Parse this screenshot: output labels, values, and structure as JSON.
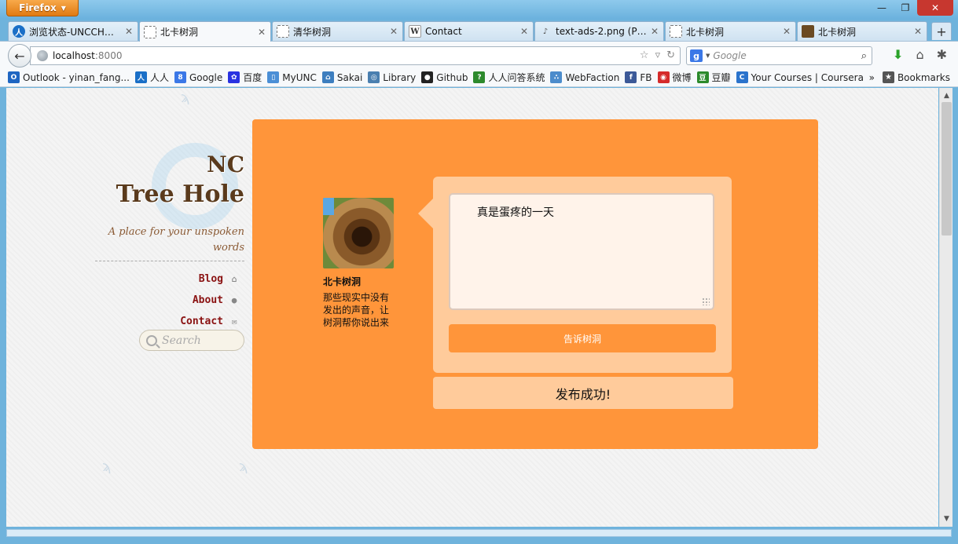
{
  "browser": {
    "app_button": "Firefox",
    "tabs": [
      {
        "label": "浏览状态-UNCCH树...",
        "icon": "renren-icon"
      },
      {
        "label": "北卡树洞",
        "icon": "blank-page-icon"
      },
      {
        "label": "清华树洞",
        "icon": "blank-page-icon"
      },
      {
        "label": "Contact",
        "icon": "w-icon"
      },
      {
        "label": "text-ads-2.png (PNG I...",
        "icon": "image-icon"
      },
      {
        "label": "北卡树洞",
        "icon": "blank-page-icon"
      },
      {
        "label": "北卡树洞",
        "icon": "tree-hole-icon"
      }
    ],
    "active_tab": 1,
    "url_host": "localhost",
    "url_port": ":8000",
    "search_placeholder": "Google",
    "bookmarks": [
      {
        "label": "Outlook - yinan_fang...",
        "icon": "outlook-icon",
        "color": "#1f66c2"
      },
      {
        "label": "人人",
        "icon": "renren-icon",
        "color": "#1a6fc7"
      },
      {
        "label": "Google",
        "icon": "google-icon",
        "color": "#3b78e7"
      },
      {
        "label": "百度",
        "icon": "baidu-paw-icon",
        "color": "#2932e1"
      },
      {
        "label": "MyUNC",
        "icon": "myunc-icon",
        "color": "#4b8fd6"
      },
      {
        "label": "Sakai",
        "icon": "sakai-icon",
        "color": "#3d7ebf"
      },
      {
        "label": "Library",
        "icon": "library-icon",
        "color": "#4a7fb0"
      },
      {
        "label": "Github",
        "icon": "github-icon",
        "color": "#222222"
      },
      {
        "label": "人人问答系统",
        "icon": "qa-icon",
        "color": "#2d8a2d"
      },
      {
        "label": "WebFaction",
        "icon": "webfaction-icon",
        "color": "#4c8ccc"
      },
      {
        "label": "FB",
        "icon": "facebook-icon",
        "color": "#3b5998"
      },
      {
        "label": "微博",
        "icon": "weibo-icon",
        "color": "#d52b2b"
      },
      {
        "label": "豆瓣",
        "icon": "douban-icon",
        "color": "#2b8a2b"
      },
      {
        "label": "Your Courses | Coursera",
        "icon": "coursera-icon",
        "color": "#2a73cc"
      }
    ],
    "bookmarks_more": "»",
    "bookmarks_menu": "Bookmarks"
  },
  "site": {
    "brand_line1": "NC",
    "brand_line2": "Tree Hole",
    "tagline": "A place for your unspoken words",
    "nav": [
      {
        "label": "Blog",
        "icon": "home-icon"
      },
      {
        "label": "About",
        "icon": "user-icon"
      },
      {
        "label": "Contact",
        "icon": "envelope-icon"
      }
    ],
    "search_placeholder": "Search"
  },
  "post": {
    "profile_name": "北卡树洞",
    "profile_desc": "那些现实中没有发出的声音，让树洞帮你说出来",
    "message": "真是蛋疼的一天",
    "submit_label": "告诉树洞",
    "success_message": "发布成功!"
  },
  "colors": {
    "card_bg": "#ff953a",
    "bubble_bg": "#ffcb9b",
    "nav_link": "#8a1212",
    "brand": "#5a3a1c"
  }
}
